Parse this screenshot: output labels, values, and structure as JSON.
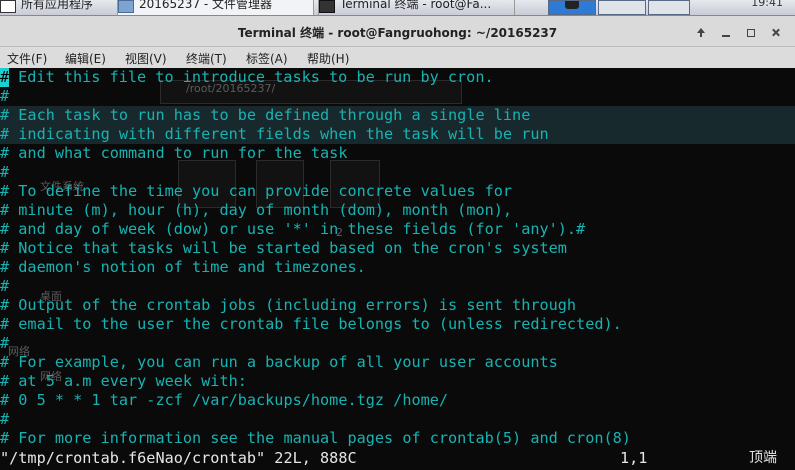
{
  "taskbar": {
    "tasks": [
      {
        "label": "所有应用程序"
      },
      {
        "label": "20165237 - 文件管理器"
      },
      {
        "label": "Terminal 终端 - root@Fa..."
      }
    ],
    "clock": "19:41"
  },
  "window": {
    "title": "Terminal 终端 - root@Fangruohong: ~/20165237"
  },
  "menubar": {
    "items": [
      "文件(F)",
      "编辑(E)",
      "视图(V)",
      "终端(T)",
      "标签(A)",
      "帮助(H)"
    ]
  },
  "background_ghost": {
    "path": "/root/20165237/",
    "labels": [
      "文件系统",
      "桌面",
      "网络",
      "网络",
      "2"
    ]
  },
  "terminal": {
    "cursor_char": "#",
    "lines": [
      " Edit this file to introduce tasks to be run by cron.",
      "#",
      "# Each task to run has to be defined through a single line",
      "# indicating with different fields when the task will be run",
      "# and what command to run for the task",
      "#",
      "# To define the time you can provide concrete values for",
      "# minute (m), hour (h), day of month (dom), month (mon),",
      "# and day of week (dow) or use '*' in these fields (for 'any').#",
      "# Notice that tasks will be started based on the cron's system",
      "# daemon's notion of time and timezones.",
      "#",
      "# Output of the crontab jobs (including errors) is sent through",
      "# email to the user the crontab file belongs to (unless redirected).",
      "#",
      "# For example, you can run a backup of all your user accounts",
      "# at 5 a.m every week with:",
      "# 0 5 * * 1 tar -zcf /var/backups/home.tgz /home/",
      "#",
      "# For more information see the manual pages of crontab(5) and cron(8)"
    ],
    "status": {
      "file": "\"/tmp/crontab.f6eNao/crontab\" 22L, 888C",
      "position": "1,1",
      "mode": "顶端"
    }
  },
  "colors": {
    "terminal_text": "#17b3b3",
    "terminal_bg": "#0a0a0a",
    "status_text": "#e6e6e6"
  }
}
